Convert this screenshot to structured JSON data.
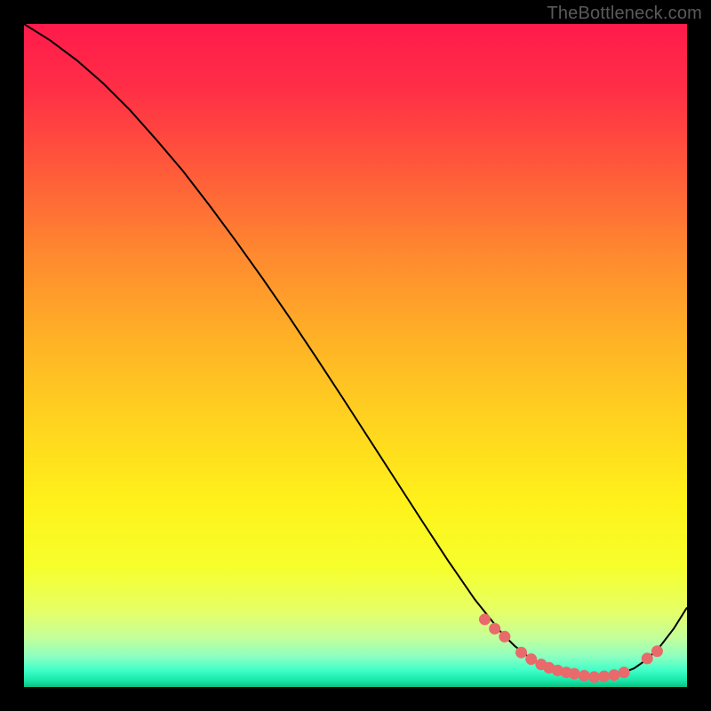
{
  "watermark": "TheBottleneck.com",
  "colors": {
    "page_bg": "#000000",
    "curve": "#000000",
    "marker_fill": "#e86a6a",
    "marker_stroke": "#d24f4f"
  },
  "gradient_stops": [
    {
      "offset": 0.0,
      "color": "#ff1a4b"
    },
    {
      "offset": 0.1,
      "color": "#ff2f46"
    },
    {
      "offset": 0.22,
      "color": "#ff5a3a"
    },
    {
      "offset": 0.35,
      "color": "#ff8a2f"
    },
    {
      "offset": 0.48,
      "color": "#ffb326"
    },
    {
      "offset": 0.6,
      "color": "#ffd31f"
    },
    {
      "offset": 0.72,
      "color": "#fff11a"
    },
    {
      "offset": 0.82,
      "color": "#f6ff2c"
    },
    {
      "offset": 0.885,
      "color": "#e6ff66"
    },
    {
      "offset": 0.925,
      "color": "#c4ff9a"
    },
    {
      "offset": 0.955,
      "color": "#8affc2"
    },
    {
      "offset": 0.975,
      "color": "#3effc8"
    },
    {
      "offset": 0.99,
      "color": "#18e8a8"
    },
    {
      "offset": 1.0,
      "color": "#0fbf84"
    }
  ],
  "chart_data": {
    "type": "line",
    "title": "",
    "xlabel": "",
    "ylabel": "",
    "xlim": [
      0,
      100
    ],
    "ylim": [
      0,
      100
    ],
    "grid": false,
    "legend": false,
    "series": [
      {
        "name": "bottleneck-curve",
        "x": [
          0,
          4,
          8,
          12,
          16,
          20,
          24,
          28,
          32,
          36,
          40,
          44,
          48,
          52,
          56,
          60,
          64,
          68,
          72,
          74,
          76,
          78,
          80,
          82,
          84,
          86,
          88,
          90,
          92,
          94,
          96,
          98,
          100
        ],
        "y": [
          100,
          97.5,
          94.5,
          91,
          87,
          82.5,
          77.8,
          72.6,
          67.2,
          61.6,
          55.8,
          49.8,
          43.7,
          37.5,
          31.3,
          25.1,
          19,
          13.2,
          8.2,
          6.2,
          4.6,
          3.4,
          2.6,
          2.0,
          1.6,
          1.5,
          1.6,
          2.0,
          2.8,
          4.2,
          6.2,
          8.8,
          12.0
        ]
      }
    ],
    "markers": {
      "name": "highlighted-points",
      "x": [
        69.5,
        71.0,
        72.5,
        75.0,
        76.5,
        78.0,
        79.2,
        80.5,
        81.8,
        83.0,
        84.5,
        86.0,
        87.5,
        89.0,
        90.5,
        94.0,
        95.5
      ],
      "y": [
        10.2,
        8.8,
        7.6,
        5.2,
        4.2,
        3.4,
        2.9,
        2.5,
        2.2,
        2.0,
        1.7,
        1.5,
        1.6,
        1.8,
        2.2,
        4.3,
        5.4
      ]
    }
  }
}
